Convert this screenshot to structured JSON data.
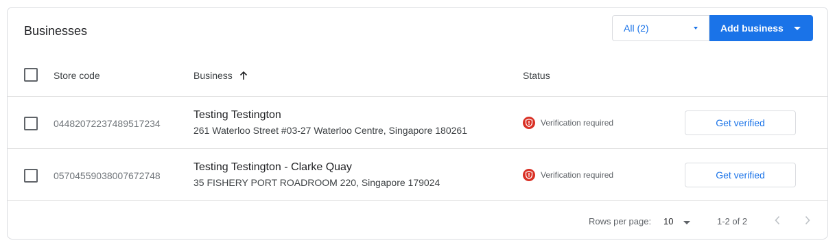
{
  "card": {
    "title": "Businesses",
    "filter_label": "All (2)",
    "add_business_label": "Add business"
  },
  "table": {
    "headers": {
      "store_code": "Store code",
      "business": "Business",
      "status": "Status"
    },
    "sort": {
      "column": "business",
      "direction": "ascending",
      "icon": "arrow-up-icon"
    },
    "rows": [
      {
        "store_code": "04482072237489517234",
        "name": "Testing Testington",
        "address": "261 Waterloo Street #03-27 Waterloo Centre, Singapore 180261",
        "status": "Verification required",
        "action": "Get verified",
        "checked": false
      },
      {
        "store_code": "05704559038007672748",
        "name": "Testing Testington - Clarke Quay",
        "address": "35 FISHERY PORT ROADROOM 220, Singapore 179024",
        "status": "Verification required",
        "action": "Get verified",
        "checked": false
      }
    ]
  },
  "footer": {
    "rows_per_page_label": "Rows per page:",
    "rows_per_page_value": "10",
    "range_label": "1-2 of 2"
  },
  "colors": {
    "accent": "#1a73e8",
    "warning": "#d93025",
    "border": "#dadce0"
  }
}
